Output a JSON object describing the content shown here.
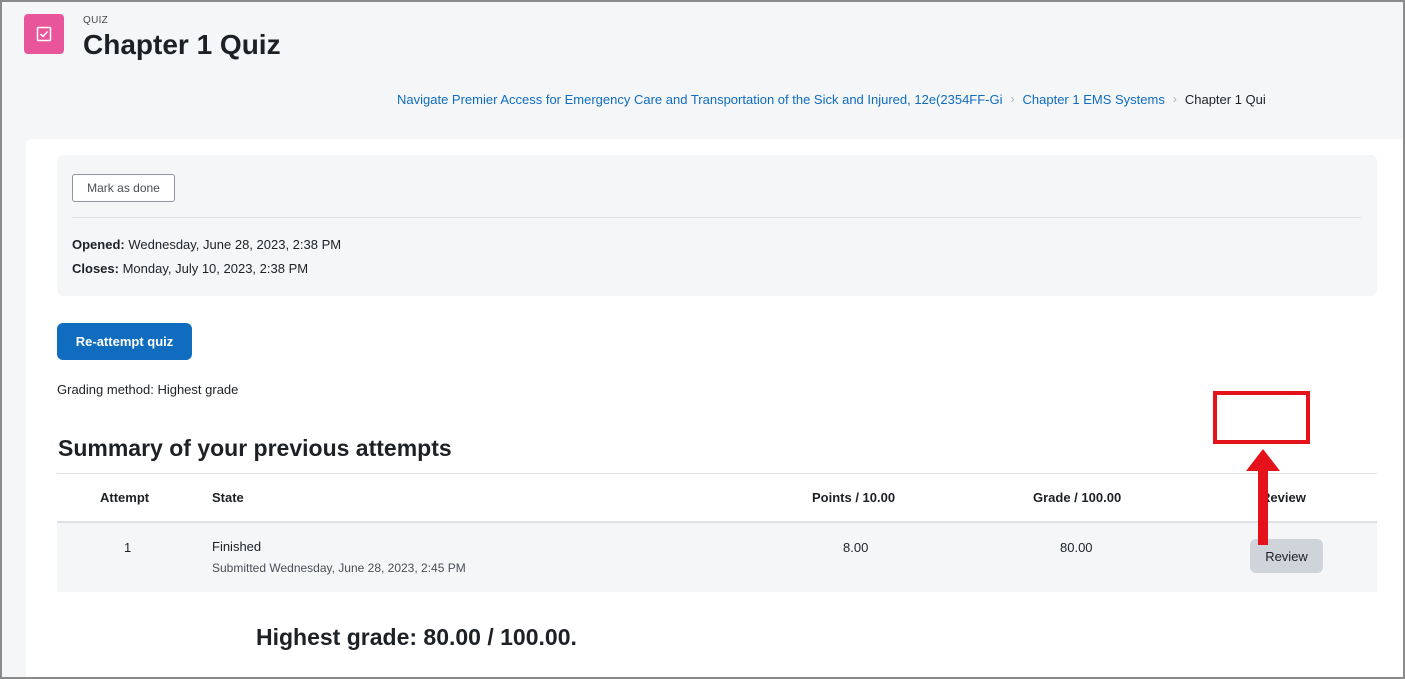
{
  "header": {
    "activity_type": "QUIZ",
    "title": "Chapter 1 Quiz"
  },
  "breadcrumb": {
    "items": [
      "Navigate Premier Access for Emergency Care and Transportation of the Sick and Injured, 12e(2354FF-Gi",
      "Chapter 1 EMS Systems",
      "Chapter 1 Qui"
    ]
  },
  "info": {
    "mark_done_label": "Mark as done",
    "opened_label": "Opened:",
    "opened_value": "Wednesday, June 28, 2023, 2:38 PM",
    "closes_label": "Closes:",
    "closes_value": "Monday, July 10, 2023, 2:38 PM"
  },
  "actions": {
    "reattempt_label": "Re-attempt quiz"
  },
  "grading_method": "Grading method: Highest grade",
  "summary": {
    "title": "Summary of your previous attempts",
    "columns": [
      "Attempt",
      "State",
      "Points / 10.00",
      "Grade / 100.00",
      "Review"
    ],
    "rows": [
      {
        "attempt": "1",
        "state": "Finished",
        "submitted": "Submitted Wednesday, June 28, 2023, 2:45 PM",
        "points": "8.00",
        "grade": "80.00",
        "review_label": "Review"
      }
    ]
  },
  "highest_grade": "Highest grade: 80.00 / 100.00.",
  "colors": {
    "accent": "#0f6cbf",
    "quiz_icon": "#e8559a",
    "annotation": "#e3121b"
  },
  "icons": {
    "quiz": "checkbox-icon",
    "breadcrumb_separator": "chevron-right-icon",
    "annotation": "arrow-up-icon"
  }
}
